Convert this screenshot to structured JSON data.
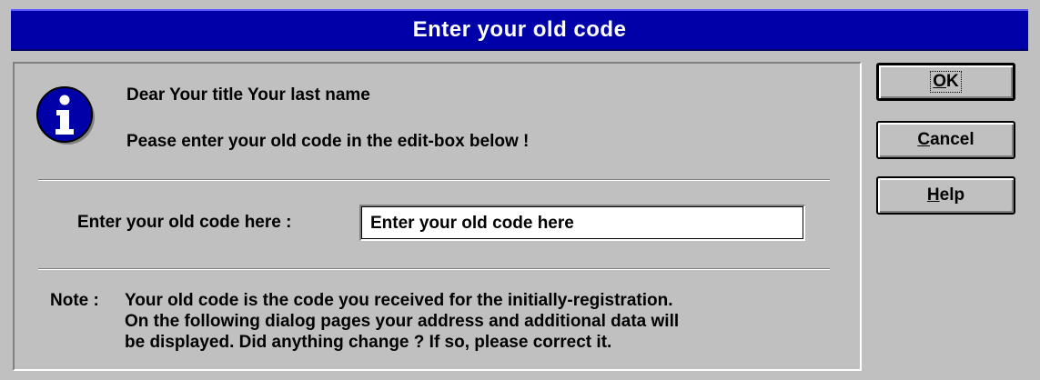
{
  "dialog": {
    "title": "Enter your old code",
    "greeting": "Dear  Your title Your last name",
    "instruction": "Pease enter your old code in the edit-box below !",
    "code_label": "Enter your old code here :",
    "code_value": "Enter your old code here",
    "note_prefix": "Note :",
    "note_lines": [
      "Your old code is the code you received for the initially-registration.",
      "On the following dialog pages your address and additional data will",
      "be displayed. Did anything change ? If so, please correct it."
    ]
  },
  "buttons": {
    "ok": "OK",
    "cancel": "Cancel",
    "help": "Help"
  },
  "icons": {
    "info": "info-icon"
  },
  "colors": {
    "titlebar": "#0000a8",
    "face": "#c0c0c0",
    "icon_blue": "#0000a8"
  }
}
